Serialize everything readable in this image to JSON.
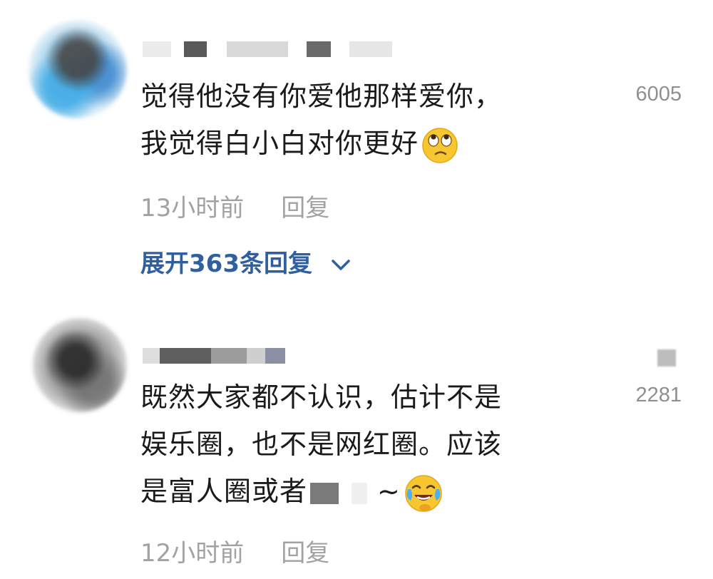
{
  "comments": [
    {
      "text_lines": [
        "觉得他没有你爱他那样爱你，",
        "我觉得白小白对你更好"
      ],
      "likes": "6005",
      "time": "13小时前",
      "reply_label": "回复",
      "expand_label": "展开363条回复",
      "emoji": "eye-roll-emoji"
    },
    {
      "text_lines": [
        "既然大家都不认识，估计不是",
        "娱乐圈，也不是网红圈。应该",
        "是富人圈或者"
      ],
      "tail": "~",
      "likes": "2281",
      "time": "12小时前",
      "reply_label": "回复",
      "emoji": "crying-laughing-emoji"
    }
  ],
  "colors": {
    "link_blue": "#2f5f9f",
    "meta_gray": "#a2a2a2",
    "text": "#1a1a1a"
  }
}
